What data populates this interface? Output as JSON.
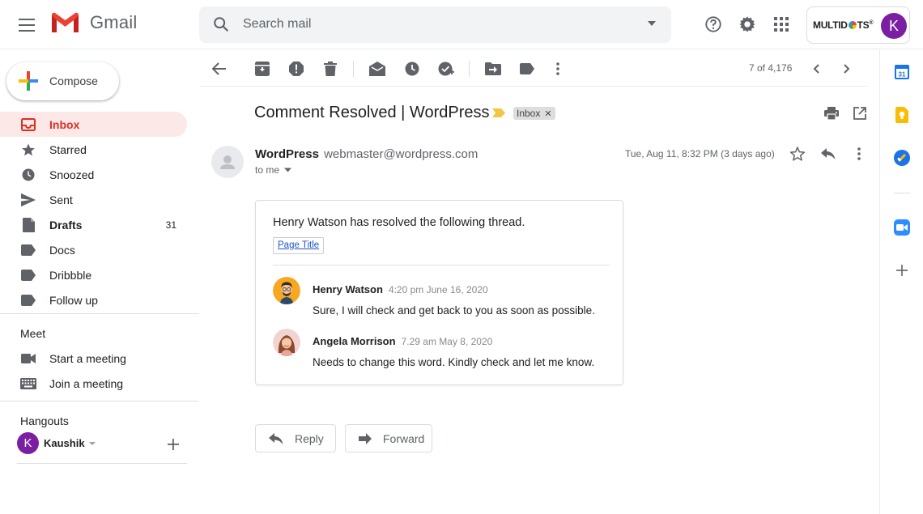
{
  "app": {
    "name": "Gmail"
  },
  "search": {
    "placeholder": "Search mail"
  },
  "account": {
    "brand": "MULTIDOTS",
    "initial": "K"
  },
  "compose": {
    "label": "Compose"
  },
  "nav": {
    "items": [
      {
        "label": "Inbox",
        "icon": "inbox-icon"
      },
      {
        "label": "Starred",
        "icon": "star-icon"
      },
      {
        "label": "Snoozed",
        "icon": "clock-icon"
      },
      {
        "label": "Sent",
        "icon": "send-icon"
      },
      {
        "label": "Drafts",
        "icon": "draft-icon",
        "count": "31"
      },
      {
        "label": "Docs",
        "icon": "label-icon"
      },
      {
        "label": "Dribbble",
        "icon": "label-icon"
      },
      {
        "label": "Follow up",
        "icon": "label-icon"
      }
    ]
  },
  "meet": {
    "title": "Meet",
    "start": "Start a meeting",
    "join": "Join a meeting"
  },
  "hangouts": {
    "title": "Hangouts",
    "user": "Kaushik",
    "initial": "K"
  },
  "toolbar": {
    "pager": "7 of 4,176"
  },
  "email": {
    "subject": "Comment Resolved | WordPress",
    "label_chip": "Inbox",
    "sender_name": "WordPress",
    "sender_email": "webmaster@wordpress.com",
    "to": "to me",
    "date": "Tue, Aug 11, 8:32 PM (3 days ago)",
    "intro": "Henry Watson has resolved the following thread.",
    "page_link": "Page Title",
    "comments": [
      {
        "name": "Henry Watson",
        "time": "4:20 pm June 16, 2020",
        "text": "Sure, I will check and get back to you as soon as possible."
      },
      {
        "name": "Angela Morrison",
        "time": "7.29 am May 8, 2020",
        "text": "Needs to change this word. Kindly check and let me know."
      }
    ]
  },
  "actions": {
    "reply": "Reply",
    "forward": "Forward"
  },
  "colors": {
    "accent_red": "#d93025",
    "active_bg": "#fce8e6",
    "avatar_purple": "#7b1fa2"
  }
}
